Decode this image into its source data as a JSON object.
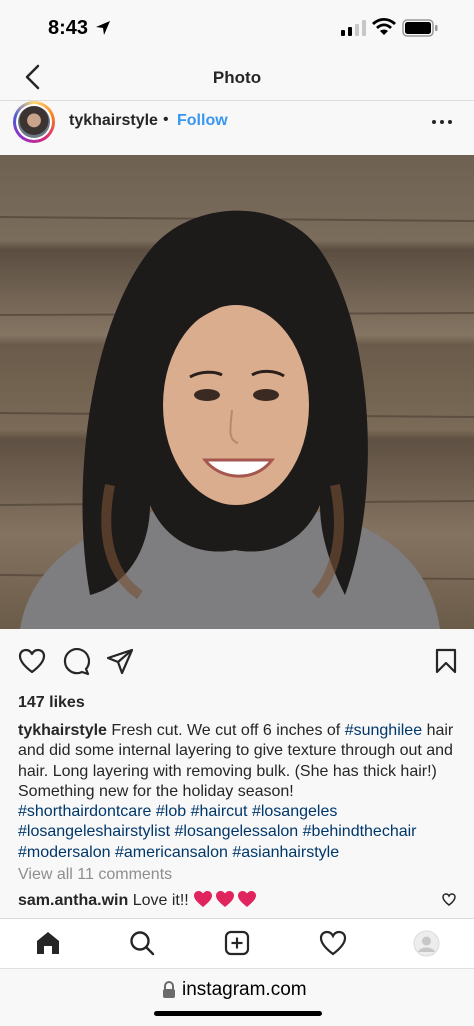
{
  "status": {
    "time": "8:43"
  },
  "header": {
    "title": "Photo"
  },
  "post": {
    "username": "tykhairstyle",
    "separator": "•",
    "follow_label": "Follow",
    "likes": "147 likes",
    "caption": {
      "user": "tykhairstyle",
      "text1": "Fresh cut. We cut off 6 inches of",
      "tag1": "#sunghilee",
      "text2": "hair and did some internal layering to give texture through out and hair. Long layering with removing bulk. (She has thick hair!) Something new for the holiday season!",
      "tags": [
        "#shorthairdontcare",
        "#lob",
        "#haircut",
        "#losangeles",
        "#losangeleshairstylist",
        "#losangelessalon",
        "#behindthechair",
        "#modersalon",
        "#americansalon",
        "#asianhairstyle"
      ]
    },
    "view_comments": "View all 11 comments",
    "comment": {
      "user": "sam.antha.win",
      "text": "Love it!!"
    }
  },
  "icons": {
    "back": "chevron-left-icon",
    "more": "more-horizontal-icon",
    "like": "heart-icon",
    "comment": "comment-icon",
    "share": "send-icon",
    "save": "bookmark-icon",
    "home": "home-icon",
    "search": "search-icon",
    "new_post": "plus-square-icon",
    "activity": "heart-icon",
    "profile": "avatar-icon",
    "lock": "lock-icon"
  },
  "browser": {
    "url": "instagram.com"
  },
  "colors": {
    "link": "#3897f0",
    "hashtag": "#00376b",
    "heart": "#e0245e"
  }
}
